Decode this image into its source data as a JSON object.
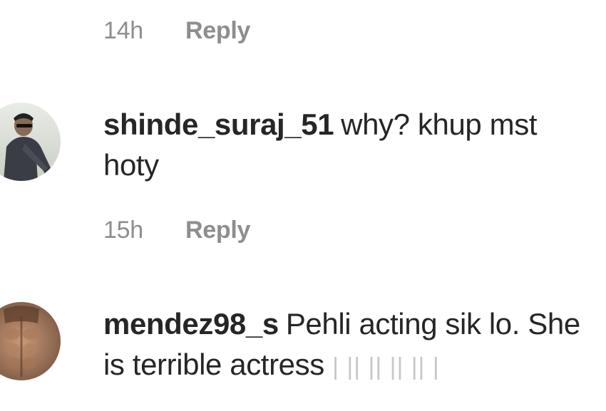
{
  "reply_top": {
    "time": "14h",
    "reply_label": "Reply"
  },
  "comments": [
    {
      "username": "shinde_suraj_51",
      "text": "why? khup mst hoty",
      "time": "15h",
      "reply_label": "Reply",
      "avatar_icon": "user-avatar-photo"
    },
    {
      "username": "mendez98_s",
      "text": "Pehli acting sik lo. She is terrible actress",
      "emoji_glyphs": "| || || || || |",
      "avatar_icon": "user-avatar-photo"
    }
  ]
}
